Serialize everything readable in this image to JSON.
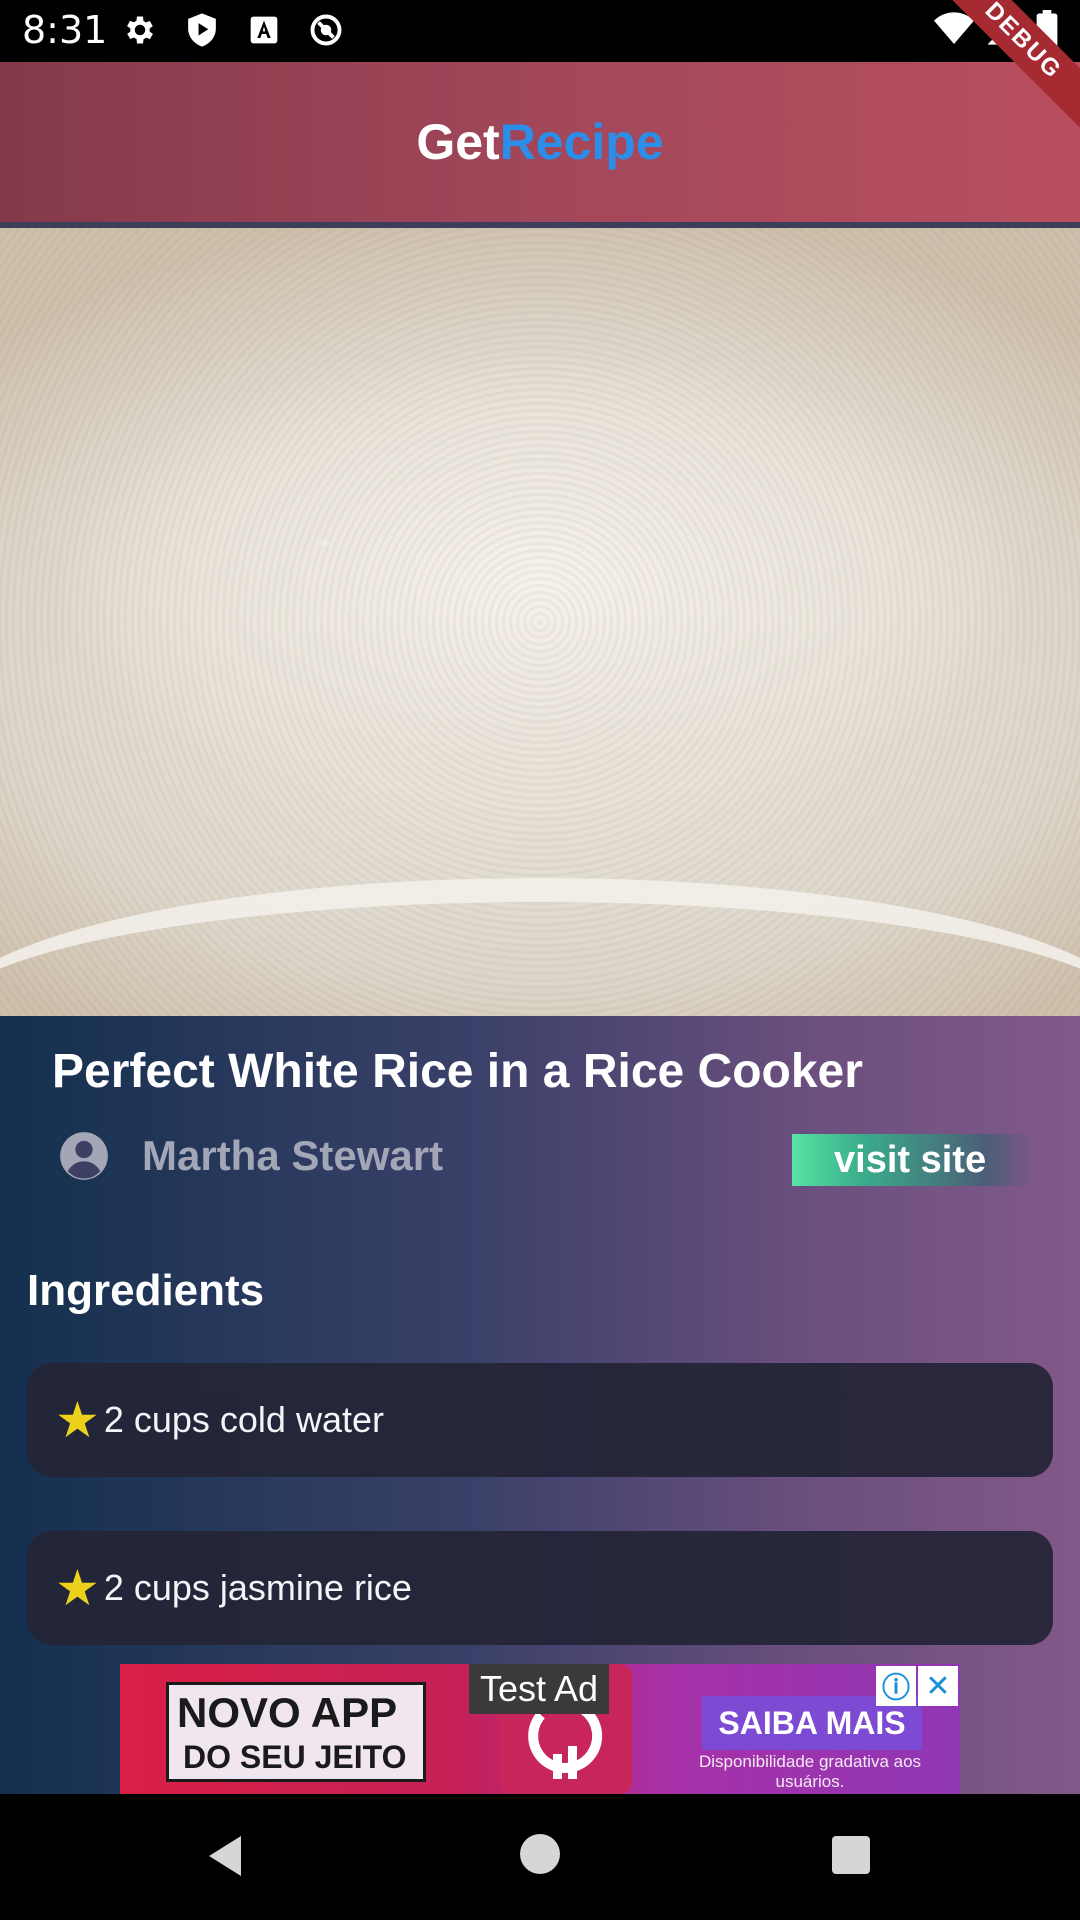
{
  "status_bar": {
    "time": "8:31",
    "icons_left": [
      "gear-icon",
      "play-shield-icon",
      "font-a-icon",
      "no-sync-icon"
    ],
    "icons_right": [
      "wifi-icon",
      "signal-icon",
      "battery-icon"
    ]
  },
  "debug_ribbon": "DEBUG",
  "app_bar": {
    "title_part1": "Get",
    "title_part2": "Recipe",
    "title_part1_color": "#ffffff",
    "title_part2_color": "#2b8ee8"
  },
  "recipe": {
    "title": "Perfect White Rice in a Rice Cooker",
    "author": "Martha Stewart",
    "visit_site_label": "visit site"
  },
  "ingredients": {
    "heading": "Ingredients",
    "items": [
      "2 cups cold water",
      "2 cups jasmine rice"
    ]
  },
  "ad": {
    "test_label": "Test Ad",
    "line1": "NOVO APP",
    "line2": "DO SEU JEITO",
    "cta": "SAIBA MAIS",
    "disclaimer": "Disponibilidade gradativa aos usuários.",
    "info_icon": "info-icon",
    "close_icon": "close-icon"
  },
  "nav_bar": {
    "icons": [
      "back-icon",
      "home-icon",
      "recents-icon"
    ]
  }
}
